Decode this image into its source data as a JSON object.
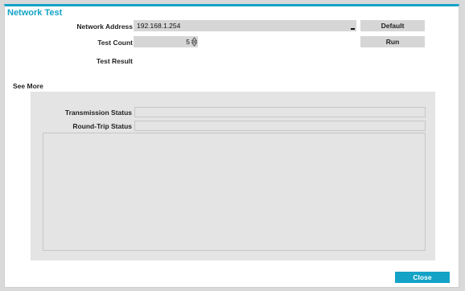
{
  "dialog": {
    "title": "Network Test"
  },
  "form": {
    "network_address_label": "Network Address",
    "network_address_value": "192.168.1.254",
    "test_count_label": "Test Count",
    "test_count_value": "5",
    "test_result_label": "Test Result",
    "default_button": "Default",
    "run_button": "Run"
  },
  "see_more": {
    "title": "See More",
    "transmission_status_label": "Transmission Status",
    "round_trip_status_label": "Round-Trip Status"
  },
  "footer": {
    "close_button": "Close"
  },
  "colors": {
    "accent": "#14a3c7",
    "field_bg": "#d6d6d6",
    "panel_bg": "#e4e4e4"
  },
  "icons": {
    "spinner": "spinner-arrows-icon",
    "caret": "text-caret-icon"
  }
}
